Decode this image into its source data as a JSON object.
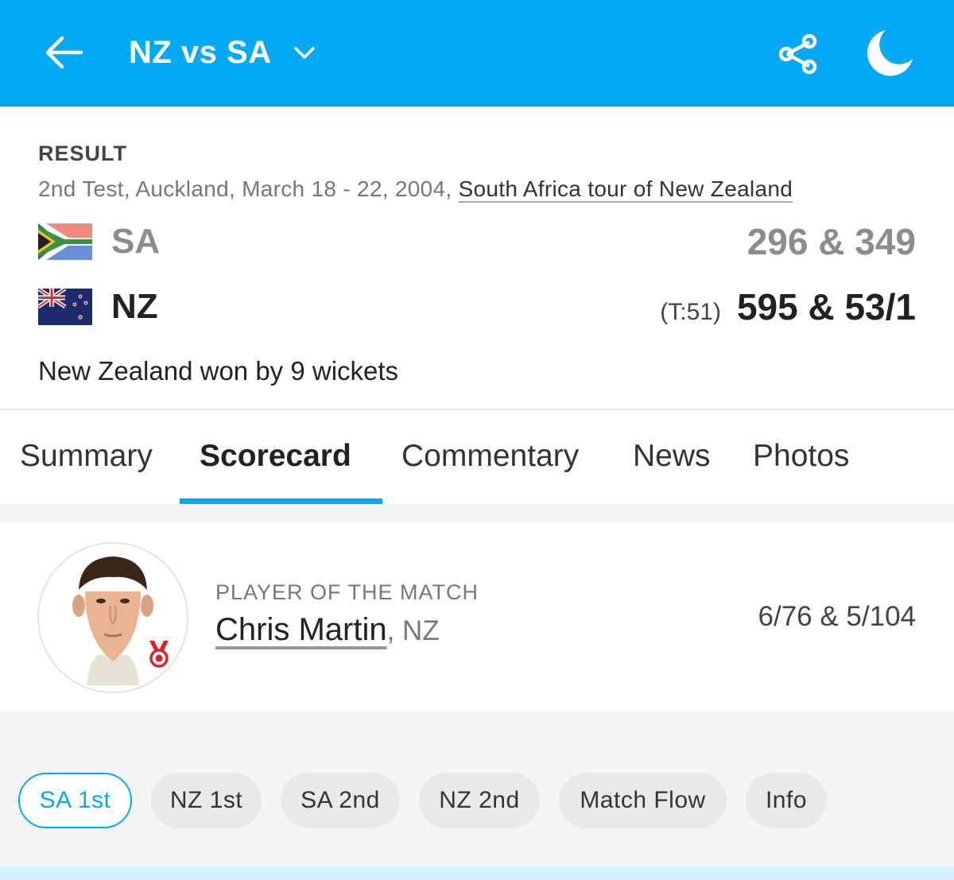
{
  "header": {
    "title": "NZ vs SA",
    "back_icon": "arrow-left-icon",
    "chevron_icon": "chevron-down-icon",
    "share_icon": "share-icon",
    "theme_icon": "moon-icon",
    "bg_color": "#03a9f4"
  },
  "result": {
    "label": "RESULT",
    "match_info_prefix": "2nd Test, Auckland, March 18 - 22, 2004,",
    "series_link": "South Africa tour of New Zealand",
    "teams": [
      {
        "abbr": "SA",
        "flag_icon": "south-africa-flag-icon",
        "target": "",
        "score": "296 & 349"
      },
      {
        "abbr": "NZ",
        "flag_icon": "new-zealand-flag-icon",
        "target": "(T:51)",
        "score": "595 & 53/1"
      }
    ],
    "result_text": "New Zealand won by 9 wickets"
  },
  "tabs": [
    {
      "label": "Summary",
      "active": false
    },
    {
      "label": "Scorecard",
      "active": true
    },
    {
      "label": "Commentary",
      "active": false
    },
    {
      "label": "News",
      "active": false
    },
    {
      "label": "Photos",
      "active": false
    }
  ],
  "player_of_match": {
    "label": "PLAYER OF THE MATCH",
    "name": "Chris Martin",
    "team": ", NZ",
    "figures": "6/76 & 5/104",
    "medal_icon": "medal-icon"
  },
  "innings_pills": [
    {
      "label": "SA 1st",
      "active": true
    },
    {
      "label": "NZ 1st",
      "active": false
    },
    {
      "label": "SA 2nd",
      "active": false
    },
    {
      "label": "NZ 2nd",
      "active": false
    },
    {
      "label": "Match Flow",
      "active": false
    },
    {
      "label": "Info",
      "active": false
    }
  ],
  "colors": {
    "accent": "#03a9f4",
    "medal": "#e02020"
  }
}
